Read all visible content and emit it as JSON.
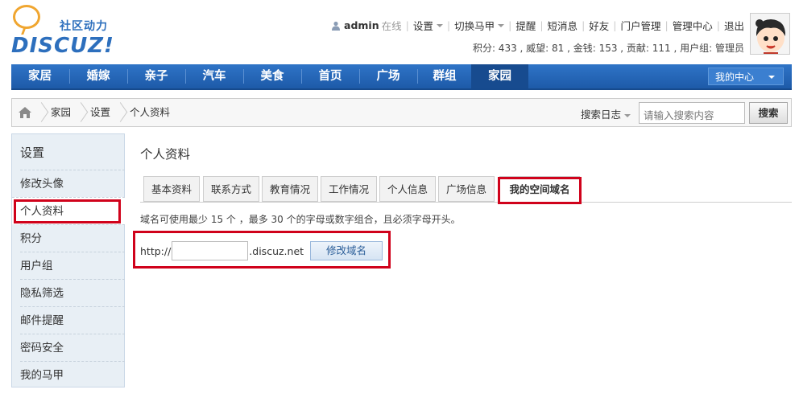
{
  "header": {
    "logo_cn": "社区动力",
    "logo_text": "DISCUZ!",
    "topnav": {
      "username": "admin",
      "status": "在线",
      "links": [
        "设置",
        "切换马甲",
        "提醒",
        "短消息",
        "好友",
        "门户管理",
        "管理中心",
        "退出"
      ]
    },
    "stats": "积分: 433 , 威望: 81 , 金钱: 153 , 贡献: 111 , 用户组: 管理员"
  },
  "mainnav": {
    "items": [
      "家居",
      "婚嫁",
      "亲子",
      "汽车",
      "美食",
      "首页",
      "广场",
      "群组",
      "家园"
    ],
    "active": "家园",
    "my_center": "我的中心"
  },
  "breadcrumb": {
    "items": [
      "家园",
      "设置",
      "个人资料"
    ],
    "search_log": "搜索日志",
    "search_placeholder": "请输入搜索内容",
    "search_button": "搜索"
  },
  "sidebar": {
    "title": "设置",
    "items": [
      "修改头像",
      "个人资料",
      "积分",
      "用户组",
      "隐私筛选",
      "邮件提醒",
      "密码安全",
      "我的马甲"
    ],
    "active": "个人资料"
  },
  "content": {
    "title": "个人资料",
    "tabs": [
      "基本资料",
      "联系方式",
      "教育情况",
      "工作情况",
      "个人信息",
      "广场信息",
      "我的空间域名"
    ],
    "active_tab": "我的空间域名",
    "hint": "域名可使用最少 15 个 ，最多 30 个的字母或数字组合，且必须字母开头。",
    "domain_prefix": "http://",
    "domain_value": "",
    "domain_suffix": ".discuz.net",
    "domain_button": "修改域名"
  },
  "colors": {
    "nav_blue": "#2f74c7",
    "highlight_red": "#d0021b",
    "sidebar_bg": "#e8eff5"
  }
}
